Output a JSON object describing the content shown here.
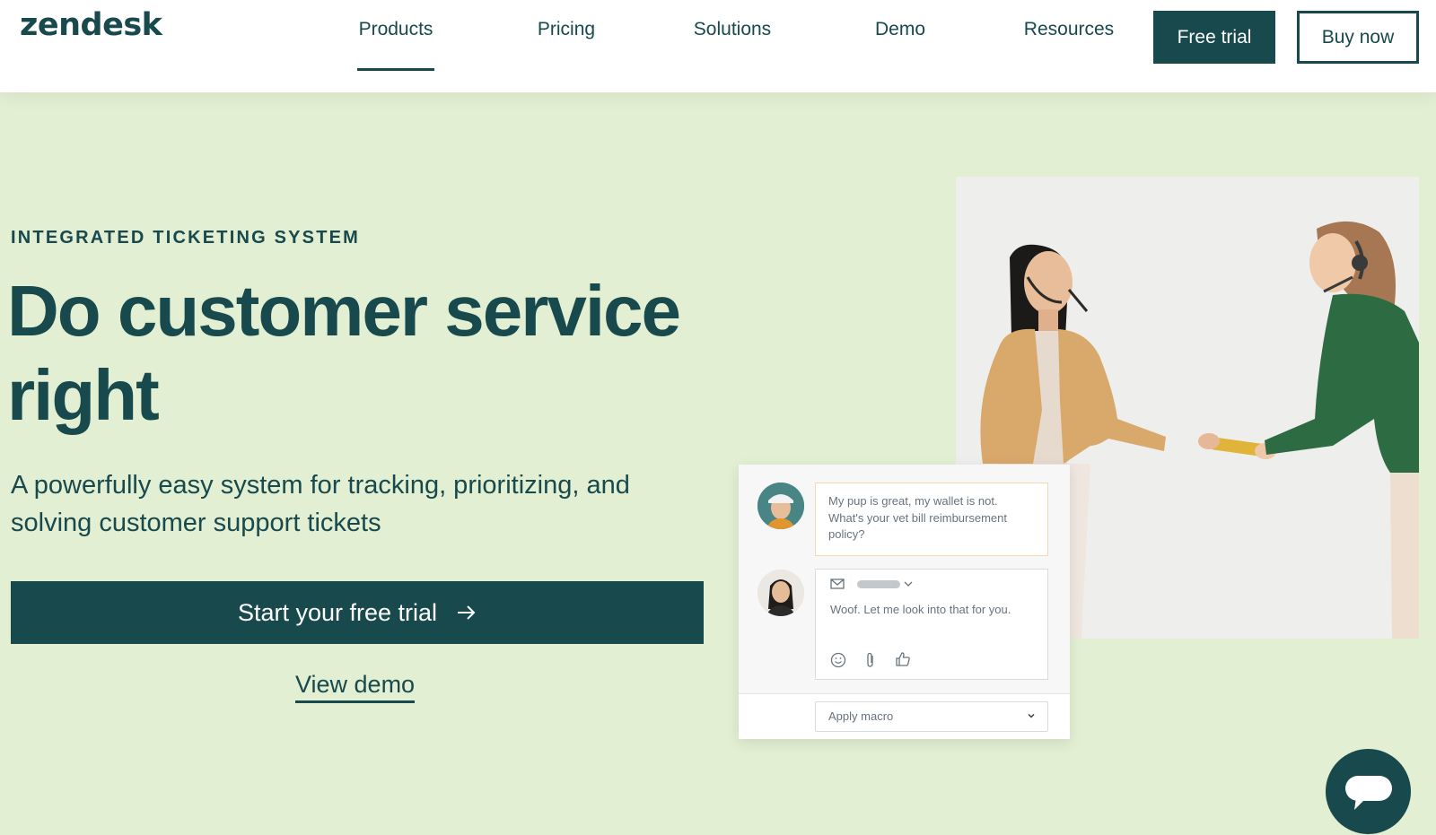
{
  "header": {
    "logo": "zendesk",
    "nav": [
      {
        "label": "Products",
        "active": true
      },
      {
        "label": "Pricing",
        "active": false
      },
      {
        "label": "Solutions",
        "active": false
      },
      {
        "label": "Demo",
        "active": false
      },
      {
        "label": "Resources",
        "active": false
      }
    ],
    "free_trial_label": "Free trial",
    "buy_now_label": "Buy now"
  },
  "hero": {
    "eyebrow": "INTEGRATED TICKETING SYSTEM",
    "headline": "Do customer service right",
    "subhead": "A powerfully easy system for tracking, prioritizing, and solving customer support tickets",
    "primary_cta": "Start your free trial",
    "primary_cta_icon": "arrow-right-icon",
    "secondary_cta": "View demo"
  },
  "ticket_card": {
    "customer_message": "My pup is great, my wallet is not. What's your vet bill reimbursement policy?",
    "agent_reply": "Woof. Let me look into that for you.",
    "reply_icons": [
      "mail-icon",
      "chevron-down-icon",
      "emoji-icon",
      "paperclip-icon",
      "thumbs-up-icon"
    ],
    "macro_label": "Apply macro"
  },
  "chat_launcher": {
    "icon": "chat-bubble-icon"
  },
  "colors": {
    "brand": "#17494d",
    "hero_bg": "#e3efd3",
    "white": "#ffffff",
    "muted_text": "#68737d"
  }
}
